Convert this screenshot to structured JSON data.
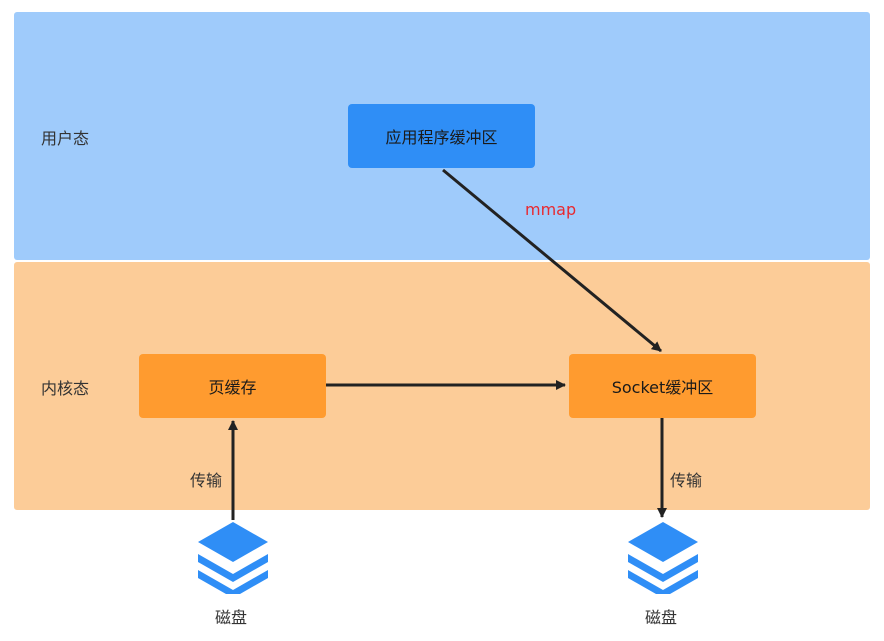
{
  "zones": {
    "user": {
      "label": "用户态",
      "color": "#9fcbfb"
    },
    "kernel": {
      "label": "内核态",
      "color": "#fccc98"
    }
  },
  "nodes": {
    "app_buffer": {
      "label": "应用程序缓冲区",
      "color": "#2f8ef6"
    },
    "page_cache": {
      "label": "页缓存",
      "color": "#ff9b2f"
    },
    "socket_buffer": {
      "label": "Socket缓冲区",
      "color": "#ff9b2f"
    }
  },
  "edges": {
    "mmap": {
      "label": "mmap",
      "color": "#e8292f"
    },
    "disk_to_page": {
      "label": "传输"
    },
    "socket_to_disk": {
      "label": "传输"
    }
  },
  "disks": {
    "left": {
      "label": "磁盘",
      "icon": "stack-layers-icon"
    },
    "right": {
      "label": "磁盘",
      "icon": "stack-layers-icon"
    }
  }
}
